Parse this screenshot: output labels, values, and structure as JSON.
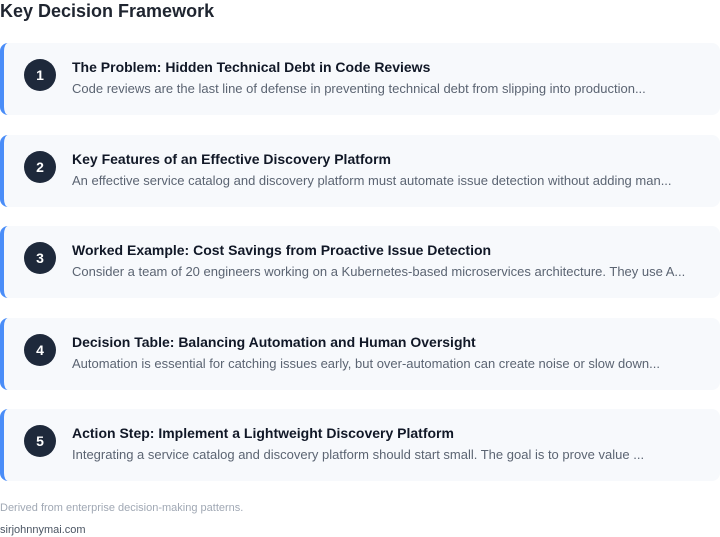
{
  "page": {
    "title": "Key Decision Framework",
    "accent_color": "#4a8df8",
    "badge_color": "#1e293b"
  },
  "cards": [
    {
      "number": "1",
      "title": "The Problem: Hidden Technical Debt in Code Reviews",
      "description": "Code reviews are the last line of defense in preventing technical debt from slipping into production..."
    },
    {
      "number": "2",
      "title": "Key Features of an Effective Discovery Platform",
      "description": "An effective service catalog and discovery platform must automate issue detection without adding man..."
    },
    {
      "number": "3",
      "title": "Worked Example: Cost Savings from Proactive Issue Detection",
      "description": "Consider a team of 20 engineers working on a Kubernetes-based microservices architecture. They use A..."
    },
    {
      "number": "4",
      "title": "Decision Table: Balancing Automation and Human Oversight",
      "description": "Automation is essential for catching issues early, but over-automation can create noise or slow down..."
    },
    {
      "number": "5",
      "title": "Action Step: Implement a Lightweight Discovery Platform",
      "description": "Integrating a service catalog and discovery platform should start small. The goal is to prove value ..."
    }
  ],
  "footer": {
    "note": "Derived from enterprise decision-making patterns.",
    "site": "sirjohnnymai.com"
  }
}
